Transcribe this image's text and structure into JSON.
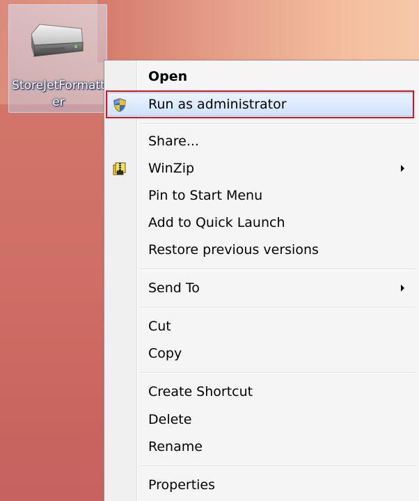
{
  "desktop": {
    "icon": {
      "label": "StoreJetFormatter",
      "icon_name": "removable-drive-icon",
      "selected": true
    }
  },
  "context_menu": {
    "groups": [
      {
        "items": [
          {
            "label": "Open",
            "bold": true,
            "icon": null,
            "submenu": false
          },
          {
            "label": "Run as administrator",
            "bold": false,
            "icon": "uac-shield-icon",
            "submenu": false,
            "highlighted": true
          }
        ]
      },
      {
        "items": [
          {
            "label": "Share...",
            "bold": false,
            "icon": null,
            "submenu": false
          },
          {
            "label": "WinZip",
            "bold": false,
            "icon": "winzip-icon",
            "submenu": true
          },
          {
            "label": "Pin to Start Menu",
            "bold": false,
            "icon": null,
            "submenu": false
          },
          {
            "label": "Add to Quick Launch",
            "bold": false,
            "icon": null,
            "submenu": false
          },
          {
            "label": "Restore previous versions",
            "bold": false,
            "icon": null,
            "submenu": false
          }
        ]
      },
      {
        "items": [
          {
            "label": "Send To",
            "bold": false,
            "icon": null,
            "submenu": true
          }
        ]
      },
      {
        "items": [
          {
            "label": "Cut",
            "bold": false,
            "icon": null,
            "submenu": false
          },
          {
            "label": "Copy",
            "bold": false,
            "icon": null,
            "submenu": false
          }
        ]
      },
      {
        "items": [
          {
            "label": "Create Shortcut",
            "bold": false,
            "icon": null,
            "submenu": false
          },
          {
            "label": "Delete",
            "bold": false,
            "icon": null,
            "submenu": false
          },
          {
            "label": "Rename",
            "bold": false,
            "icon": null,
            "submenu": false
          }
        ]
      },
      {
        "items": [
          {
            "label": "Properties",
            "bold": false,
            "icon": null,
            "submenu": false
          }
        ]
      }
    ]
  },
  "colors": {
    "highlight_border": "#e0101a",
    "menu_background": "#f5f5f5",
    "hover_fill": "#dcebfc"
  }
}
